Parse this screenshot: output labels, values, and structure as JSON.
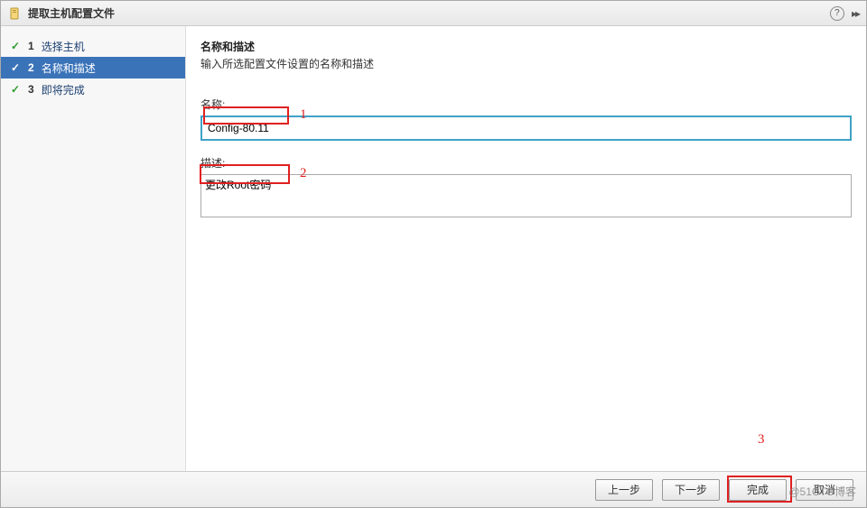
{
  "titlebar": {
    "title": "提取主机配置文件"
  },
  "sidebar": {
    "steps": [
      {
        "num": "1",
        "label": "选择主机",
        "done": true,
        "active": false
      },
      {
        "num": "2",
        "label": "名称和描述",
        "done": true,
        "active": true
      },
      {
        "num": "3",
        "label": "即将完成",
        "done": true,
        "active": false
      }
    ]
  },
  "main": {
    "section_title": "名称和描述",
    "section_desc": "输入所选配置文件设置的名称和描述",
    "name_label": "名称:",
    "name_value": "Config-80.11",
    "desc_label": "描述:",
    "desc_value": "更改Root密码"
  },
  "annotations": {
    "a1": "1",
    "a2": "2",
    "a3": "3"
  },
  "footer": {
    "back": "上一步",
    "next": "下一步",
    "finish": "完成",
    "cancel": "取消"
  },
  "watermark": "@51CTO博客"
}
